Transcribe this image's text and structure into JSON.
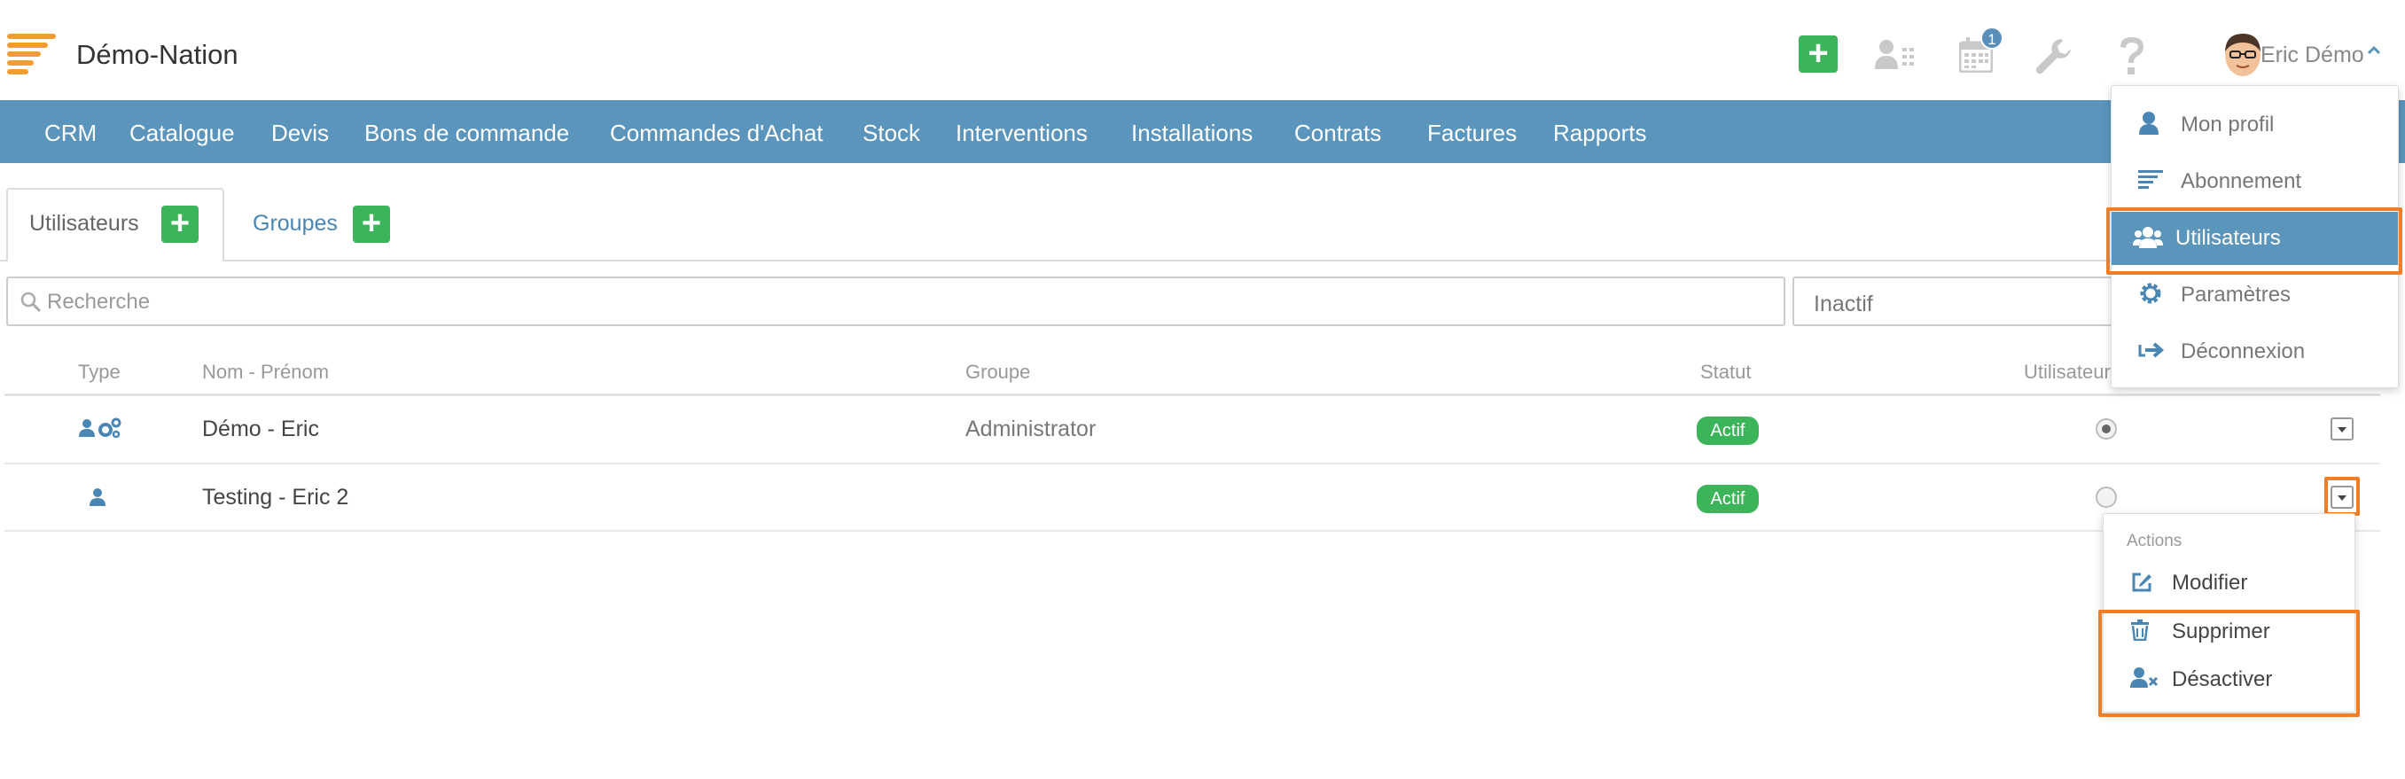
{
  "app": {
    "title": "Démo-Nation"
  },
  "header": {
    "notification_count": "1",
    "user_name": "Eric Démo"
  },
  "nav": {
    "items": [
      "CRM",
      "Catalogue",
      "Devis",
      "Bons de commande",
      "Commandes d'Achat",
      "Stock",
      "Interventions",
      "Installations",
      "Contrats",
      "Factures",
      "Rapports"
    ]
  },
  "tabs": [
    {
      "label": "Utilisateurs",
      "active": true
    },
    {
      "label": "Groupes",
      "active": false
    }
  ],
  "search": {
    "placeholder": "Recherche",
    "value": ""
  },
  "filter": {
    "value": "Inactif"
  },
  "table": {
    "columns": [
      "Type",
      "Nom - Prénom",
      "Groupe",
      "Statut",
      "Utilisateur"
    ],
    "rows": [
      {
        "name": "Démo - Eric",
        "group": "Administrator",
        "status": "Actif",
        "radio_selected": true
      },
      {
        "name": "Testing - Eric 2",
        "group": "",
        "status": "Actif",
        "radio_selected": false
      }
    ]
  },
  "user_menu": {
    "items": [
      "Mon profil",
      "Abonnement",
      "Utilisateurs",
      "Paramètres",
      "Déconnexion"
    ],
    "active_index": 2
  },
  "actions_menu": {
    "header": "Actions",
    "items": [
      "Modifier",
      "Supprimer",
      "Désactiver"
    ]
  },
  "colors": {
    "navbar": "#5b95bc",
    "accent_green": "#3cb55a",
    "logo_orange": "#f39c34",
    "highlight_orange": "#f07e26"
  }
}
